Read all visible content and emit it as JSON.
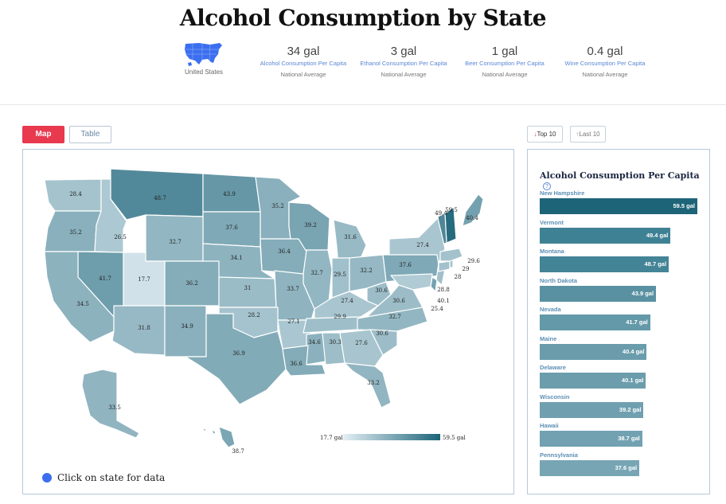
{
  "page": {
    "title": "Alcohol Consumption by State"
  },
  "summary": {
    "region_label": "United States",
    "stats": [
      {
        "value": "34 gal",
        "label": "Alcohol Consumption Per Capita",
        "sub": "National Average"
      },
      {
        "value": "3 gal",
        "label": "Ethanol Consumption Per Capita",
        "sub": "National Average"
      },
      {
        "value": "1 gal",
        "label": "Beer Consumption Per Capita",
        "sub": "National Average"
      },
      {
        "value": "0.4 gal",
        "label": "Wine Consumption Per Capita",
        "sub": "National Average"
      }
    ]
  },
  "view_toggle": {
    "map_label": "Map",
    "table_label": "Table",
    "active": "Map"
  },
  "rank_toggle": {
    "top_label": "Top 10",
    "last_label": "Last 10",
    "active": "Top 10"
  },
  "map": {
    "click_note": "Click on state for data",
    "legend": {
      "min": "17.7 gal",
      "max": "59.5 gal",
      "min_color": "#e4eff5",
      "max_color": "#1c6478"
    },
    "state_values": [
      {
        "label": "28.4"
      },
      {
        "label": "35.2"
      },
      {
        "label": "26.5"
      },
      {
        "label": "48.7"
      },
      {
        "label": "43.9"
      },
      {
        "label": "35.2"
      },
      {
        "label": "37.6"
      },
      {
        "label": "32.7"
      },
      {
        "label": "39.2"
      },
      {
        "label": "40.4"
      },
      {
        "label": "59.5"
      },
      {
        "label": "49.4"
      },
      {
        "label": "27.4"
      },
      {
        "label": "31.6"
      },
      {
        "label": "36.4"
      },
      {
        "label": "34.1"
      },
      {
        "label": "37.6"
      },
      {
        "label": "29.6"
      },
      {
        "label": "41.7"
      },
      {
        "label": "17.7"
      },
      {
        "label": "36.2"
      },
      {
        "label": "32.7"
      },
      {
        "label": "29.5"
      },
      {
        "label": "32.2"
      },
      {
        "label": "29"
      },
      {
        "label": "28"
      },
      {
        "label": "28.8"
      },
      {
        "label": "31"
      },
      {
        "label": "33.7"
      },
      {
        "label": "30.6"
      },
      {
        "label": "40.1"
      },
      {
        "label": "25.4"
      },
      {
        "label": "34.5"
      },
      {
        "label": "27.4"
      },
      {
        "label": "30.6"
      },
      {
        "label": "28.2"
      },
      {
        "label": "27.1"
      },
      {
        "label": "29.9"
      },
      {
        "label": "32.7"
      },
      {
        "label": "31.8"
      },
      {
        "label": "34.9"
      },
      {
        "label": "30.6"
      },
      {
        "label": "34.6"
      },
      {
        "label": "30.3"
      },
      {
        "label": "27.6"
      },
      {
        "label": "36.9"
      },
      {
        "label": "36.6"
      },
      {
        "label": "33.2"
      },
      {
        "label": "33.5"
      },
      {
        "label": "38.7"
      }
    ]
  },
  "ranking": {
    "title": "Alcohol Consumption Per Capita",
    "help_icon": "question-circle-icon",
    "max_value": 59.5,
    "items": [
      {
        "state": "New Hampshire",
        "value": 59.5,
        "value_label": "59.5 gal",
        "color": "#1d6478"
      },
      {
        "state": "Vermont",
        "value": 49.4,
        "value_label": "49.4 gal",
        "color": "#3f8194"
      },
      {
        "state": "Montana",
        "value": 48.7,
        "value_label": "48.7 gal",
        "color": "#438497"
      },
      {
        "state": "North Dakota",
        "value": 43.9,
        "value_label": "43.9 gal",
        "color": "#5991a2"
      },
      {
        "state": "Nevada",
        "value": 41.7,
        "value_label": "41.7 gal",
        "color": "#6499a9"
      },
      {
        "state": "Maine",
        "value": 40.4,
        "value_label": "40.4 gal",
        "color": "#6a9cac"
      },
      {
        "state": "Delaware",
        "value": 40.1,
        "value_label": "40.1 gal",
        "color": "#6b9dad"
      },
      {
        "state": "Wisconsin",
        "value": 39.2,
        "value_label": "39.2 gal",
        "color": "#70a0b0"
      },
      {
        "state": "Hawaii",
        "value": 38.7,
        "value_label": "38.7 gal",
        "color": "#72a1b1"
      },
      {
        "state": "Pennsylvania",
        "value": 37.6,
        "value_label": "37.6 gal",
        "color": "#77a5b4"
      }
    ]
  }
}
